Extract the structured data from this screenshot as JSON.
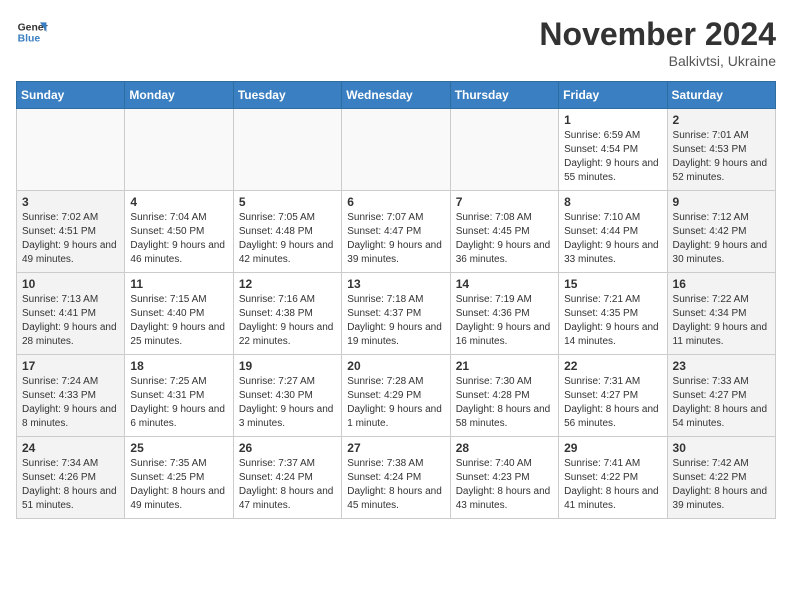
{
  "header": {
    "logo_line1": "General",
    "logo_line2": "Blue",
    "month": "November 2024",
    "location": "Balkivtsi, Ukraine"
  },
  "weekdays": [
    "Sunday",
    "Monday",
    "Tuesday",
    "Wednesday",
    "Thursday",
    "Friday",
    "Saturday"
  ],
  "weeks": [
    [
      {
        "day": "",
        "info": "",
        "empty": true
      },
      {
        "day": "",
        "info": "",
        "empty": true
      },
      {
        "day": "",
        "info": "",
        "empty": true
      },
      {
        "day": "",
        "info": "",
        "empty": true
      },
      {
        "day": "",
        "info": "",
        "empty": true
      },
      {
        "day": "1",
        "info": "Sunrise: 6:59 AM\nSunset: 4:54 PM\nDaylight: 9 hours and 55 minutes."
      },
      {
        "day": "2",
        "info": "Sunrise: 7:01 AM\nSunset: 4:53 PM\nDaylight: 9 hours and 52 minutes.",
        "weekend": true
      }
    ],
    [
      {
        "day": "3",
        "info": "Sunrise: 7:02 AM\nSunset: 4:51 PM\nDaylight: 9 hours and 49 minutes.",
        "weekend": true
      },
      {
        "day": "4",
        "info": "Sunrise: 7:04 AM\nSunset: 4:50 PM\nDaylight: 9 hours and 46 minutes."
      },
      {
        "day": "5",
        "info": "Sunrise: 7:05 AM\nSunset: 4:48 PM\nDaylight: 9 hours and 42 minutes."
      },
      {
        "day": "6",
        "info": "Sunrise: 7:07 AM\nSunset: 4:47 PM\nDaylight: 9 hours and 39 minutes."
      },
      {
        "day": "7",
        "info": "Sunrise: 7:08 AM\nSunset: 4:45 PM\nDaylight: 9 hours and 36 minutes."
      },
      {
        "day": "8",
        "info": "Sunrise: 7:10 AM\nSunset: 4:44 PM\nDaylight: 9 hours and 33 minutes."
      },
      {
        "day": "9",
        "info": "Sunrise: 7:12 AM\nSunset: 4:42 PM\nDaylight: 9 hours and 30 minutes.",
        "weekend": true
      }
    ],
    [
      {
        "day": "10",
        "info": "Sunrise: 7:13 AM\nSunset: 4:41 PM\nDaylight: 9 hours and 28 minutes.",
        "weekend": true
      },
      {
        "day": "11",
        "info": "Sunrise: 7:15 AM\nSunset: 4:40 PM\nDaylight: 9 hours and 25 minutes."
      },
      {
        "day": "12",
        "info": "Sunrise: 7:16 AM\nSunset: 4:38 PM\nDaylight: 9 hours and 22 minutes."
      },
      {
        "day": "13",
        "info": "Sunrise: 7:18 AM\nSunset: 4:37 PM\nDaylight: 9 hours and 19 minutes."
      },
      {
        "day": "14",
        "info": "Sunrise: 7:19 AM\nSunset: 4:36 PM\nDaylight: 9 hours and 16 minutes."
      },
      {
        "day": "15",
        "info": "Sunrise: 7:21 AM\nSunset: 4:35 PM\nDaylight: 9 hours and 14 minutes."
      },
      {
        "day": "16",
        "info": "Sunrise: 7:22 AM\nSunset: 4:34 PM\nDaylight: 9 hours and 11 minutes.",
        "weekend": true
      }
    ],
    [
      {
        "day": "17",
        "info": "Sunrise: 7:24 AM\nSunset: 4:33 PM\nDaylight: 9 hours and 8 minutes.",
        "weekend": true
      },
      {
        "day": "18",
        "info": "Sunrise: 7:25 AM\nSunset: 4:31 PM\nDaylight: 9 hours and 6 minutes."
      },
      {
        "day": "19",
        "info": "Sunrise: 7:27 AM\nSunset: 4:30 PM\nDaylight: 9 hours and 3 minutes."
      },
      {
        "day": "20",
        "info": "Sunrise: 7:28 AM\nSunset: 4:29 PM\nDaylight: 9 hours and 1 minute."
      },
      {
        "day": "21",
        "info": "Sunrise: 7:30 AM\nSunset: 4:28 PM\nDaylight: 8 hours and 58 minutes."
      },
      {
        "day": "22",
        "info": "Sunrise: 7:31 AM\nSunset: 4:27 PM\nDaylight: 8 hours and 56 minutes."
      },
      {
        "day": "23",
        "info": "Sunrise: 7:33 AM\nSunset: 4:27 PM\nDaylight: 8 hours and 54 minutes.",
        "weekend": true
      }
    ],
    [
      {
        "day": "24",
        "info": "Sunrise: 7:34 AM\nSunset: 4:26 PM\nDaylight: 8 hours and 51 minutes.",
        "weekend": true
      },
      {
        "day": "25",
        "info": "Sunrise: 7:35 AM\nSunset: 4:25 PM\nDaylight: 8 hours and 49 minutes."
      },
      {
        "day": "26",
        "info": "Sunrise: 7:37 AM\nSunset: 4:24 PM\nDaylight: 8 hours and 47 minutes."
      },
      {
        "day": "27",
        "info": "Sunrise: 7:38 AM\nSunset: 4:24 PM\nDaylight: 8 hours and 45 minutes."
      },
      {
        "day": "28",
        "info": "Sunrise: 7:40 AM\nSunset: 4:23 PM\nDaylight: 8 hours and 43 minutes."
      },
      {
        "day": "29",
        "info": "Sunrise: 7:41 AM\nSunset: 4:22 PM\nDaylight: 8 hours and 41 minutes."
      },
      {
        "day": "30",
        "info": "Sunrise: 7:42 AM\nSunset: 4:22 PM\nDaylight: 8 hours and 39 minutes.",
        "weekend": true
      }
    ]
  ]
}
